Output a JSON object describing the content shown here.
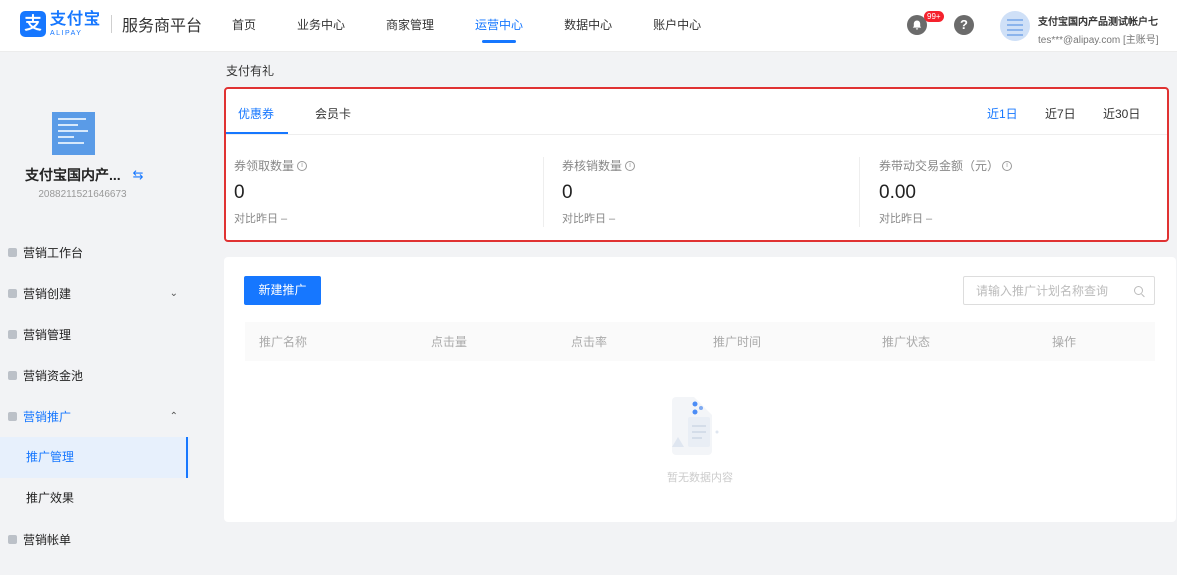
{
  "header": {
    "logo_glyph": "支",
    "logo_cn": "支付宝",
    "logo_en": "ALIPAY",
    "platform": "服务商平台",
    "nav": [
      "首页",
      "业务中心",
      "商家管理",
      "运营中心",
      "数据中心",
      "账户中心"
    ],
    "active_nav": "运营中心",
    "notification_count": "99+",
    "help_glyph": "?",
    "user_name": "支付宝国内产品测试帐户七",
    "user_account": "tes***@alipay.com [主账号]",
    "icons": [
      "bell-icon",
      "help-icon",
      "avatar"
    ]
  },
  "sidebar": {
    "merchant_name": "支付宝国内产...",
    "switch_glyph": "⇆",
    "merchant_id": "2088211521646673",
    "menu": [
      {
        "label": "营销工作台",
        "icon": "home-icon"
      },
      {
        "label": "营销创建",
        "icon": "tag-icon",
        "caret": "⌄"
      },
      {
        "label": "营销管理",
        "icon": "list-icon"
      },
      {
        "label": "营销资金池",
        "icon": "chart-icon"
      },
      {
        "label": "营销推广",
        "icon": "megaphone-icon",
        "caret": "⌃",
        "expanded": true
      }
    ],
    "submenu": [
      "推广管理",
      "推广效果"
    ],
    "active_submenu": "推广管理",
    "last_item": {
      "label": "营销帐单",
      "icon": "bill-icon"
    }
  },
  "page": {
    "breadcrumb": "支付有礼",
    "tabs": [
      "优惠券",
      "会员卡"
    ],
    "active_tab": "优惠券",
    "ranges": [
      "近1日",
      "近7日",
      "近30日"
    ],
    "active_range": "近1日",
    "metrics": [
      {
        "label": "券领取数量",
        "value": "0",
        "compare": "对比昨日 –"
      },
      {
        "label": "券核销数量",
        "value": "0",
        "compare": "对比昨日 –"
      },
      {
        "label": "券带动交易金额（元）",
        "value": "0.00",
        "compare": "对比昨日 –"
      }
    ],
    "info_glyph": "i",
    "new_button": "新建推广",
    "search_placeholder": "请输入推广计划名称查询",
    "columns": [
      "推广名称",
      "点击量",
      "点击率",
      "推广时间",
      "推广状态",
      "操作"
    ],
    "empty_text": "暂无数据内容"
  },
  "colors": {
    "accent": "#1677ff",
    "highlight_border": "#e03232",
    "badge": "#f5222d"
  }
}
